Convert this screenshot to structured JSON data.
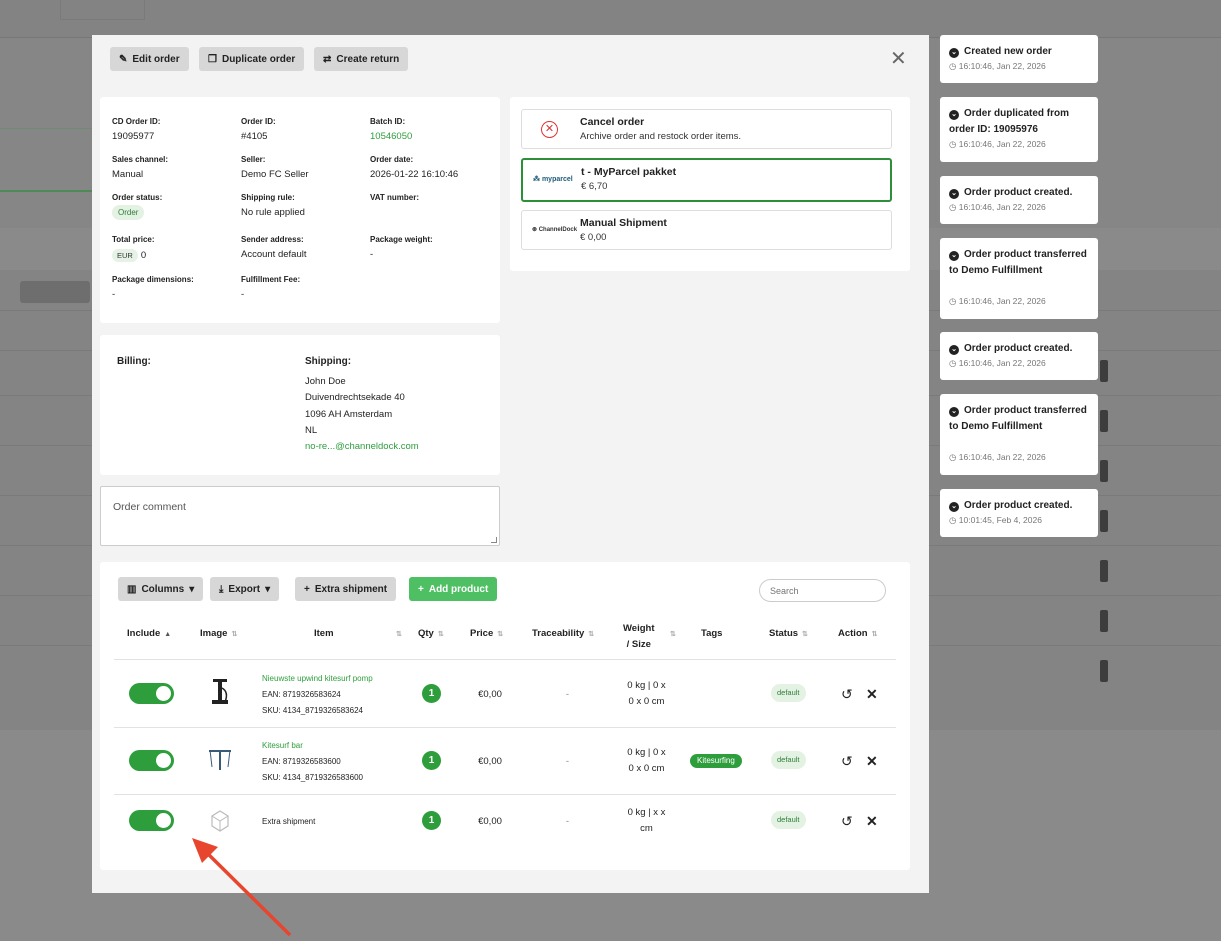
{
  "toolbar": {
    "edit_order": "Edit order",
    "duplicate_order": "Duplicate order",
    "create_return": "Create return"
  },
  "order": {
    "cd_order_id_label": "CD Order ID:",
    "cd_order_id": "19095977",
    "order_id_label": "Order ID:",
    "order_id": "#4105",
    "batch_id_label": "Batch ID:",
    "batch_id": "10546050",
    "sales_channel_label": "Sales channel:",
    "sales_channel": "Manual",
    "seller_label": "Seller:",
    "seller": "Demo FC Seller",
    "order_date_label": "Order date:",
    "order_date": "2026-01-22 16:10:46",
    "order_status_label": "Order status:",
    "order_status": "Order",
    "shipping_rule_label": "Shipping rule:",
    "shipping_rule": "No rule applied",
    "vat_label": "VAT number:",
    "total_price_label": "Total price:",
    "currency": "EUR",
    "total_price": "0",
    "sender_label": "Sender address:",
    "sender": "Account default",
    "package_weight_label": "Package weight:",
    "package_weight": "-",
    "package_dim_label": "Package dimensions:",
    "package_dim": "-",
    "fulfillment_fee_label": "Fulfillment Fee:",
    "fulfillment_fee": "-"
  },
  "carriers": [
    {
      "title": "Cancel order",
      "subtitle": "Archive order and restock order items."
    },
    {
      "title": "t - MyParcel pakket",
      "subtitle": "€ 6,70",
      "logo": "myparcel"
    },
    {
      "title": "Manual Shipment",
      "subtitle": "€ 0,00",
      "logo": "ChannelDock"
    }
  ],
  "address": {
    "billing_label": "Billing:",
    "shipping_label": "Shipping:",
    "lines": [
      "John Doe",
      "Duivendrechtsekade 40",
      "1096 AH Amsterdam",
      "NL"
    ],
    "email": "no-re...@channeldock.com"
  },
  "comment_placeholder": "Order comment",
  "table_toolbar": {
    "columns": "Columns",
    "export": "Export",
    "extra_shipment": "Extra shipment",
    "add_product": "Add product",
    "search_placeholder": "Search"
  },
  "headers": {
    "include": "Include",
    "image": "Image",
    "item": "Item",
    "qty": "Qty",
    "price": "Price",
    "traceability": "Traceability",
    "weight1": "Weight",
    "weight2": "/ Size",
    "tags": "Tags",
    "status": "Status",
    "action": "Action"
  },
  "rows": [
    {
      "name": "Nieuwste upwind kitesurf pomp",
      "ean": "EAN: 8719326583624",
      "sku": "SKU: 4134_8719326583624",
      "qty": "1",
      "price": "€0,00",
      "trace": "-",
      "w1": "0 kg | 0 x",
      "w2": "0 x 0 cm",
      "tag": "",
      "status": "default"
    },
    {
      "name": "Kitesurf bar",
      "ean": "EAN: 8719326583600",
      "sku": "SKU: 4134_8719326583600",
      "qty": "1",
      "price": "€0,00",
      "trace": "-",
      "w1": "0 kg | 0 x",
      "w2": "0 x 0 cm",
      "tag": "Kitesurfing",
      "status": "default"
    },
    {
      "name": "Extra shipment",
      "qty": "1",
      "price": "€0,00",
      "trace": "-",
      "w1": "0 kg | x x",
      "w2": "cm",
      "status": "default"
    }
  ],
  "timeline": [
    {
      "title": "Created new order",
      "time": "16:10:46, Jan 22, 2026"
    },
    {
      "title": "Order duplicated from order ID: 19095976",
      "time": "16:10:46, Jan 22, 2026"
    },
    {
      "title": "Order product created.",
      "time": "16:10:46, Jan 22, 2026"
    },
    {
      "title": "Order product transferred to Demo Fulfillment",
      "time": "16:10:46, Jan 22, 2026"
    },
    {
      "title": "Order product created.",
      "time": "16:10:46, Jan 22, 2026"
    },
    {
      "title": "Order product transferred to Demo Fulfillment",
      "time": "16:10:46, Jan 22, 2026"
    },
    {
      "title": "Order product created.",
      "time": "10:01:45, Feb 4, 2026"
    }
  ],
  "colors": {
    "accent": "#2e9e3d",
    "overlay": "#8a8a8a",
    "arrow": "#e8452f"
  }
}
